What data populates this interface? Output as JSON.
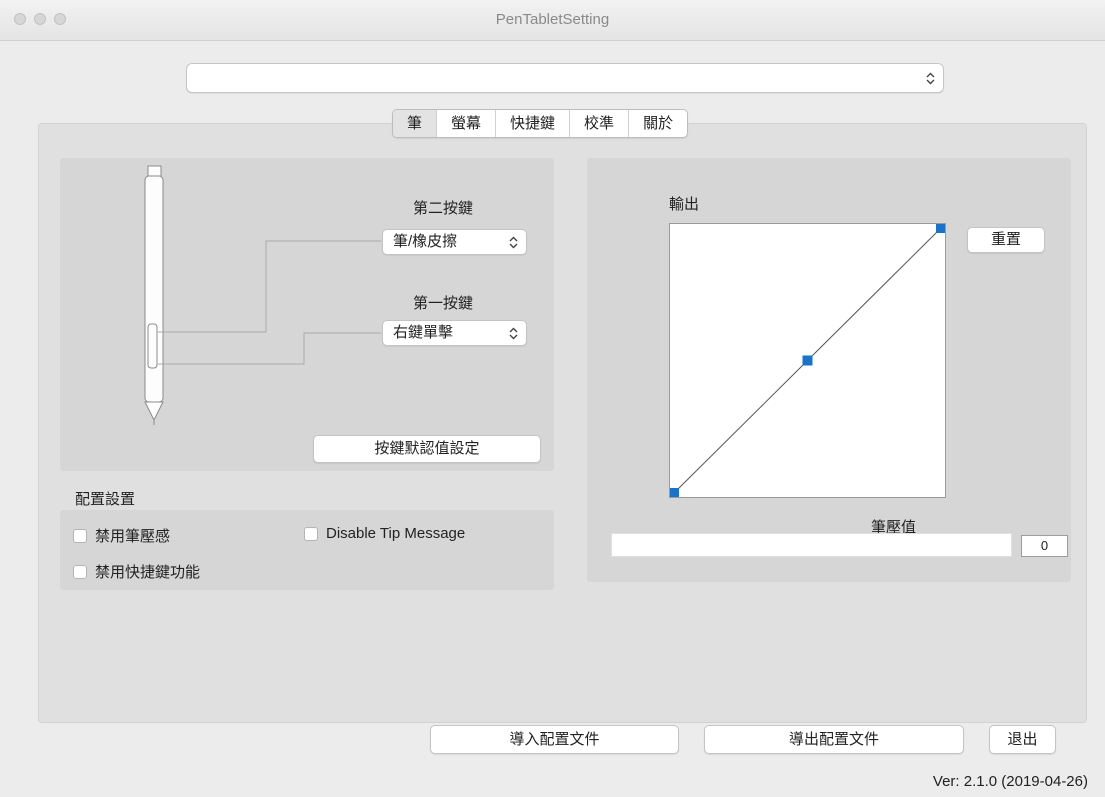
{
  "window": {
    "title": "PenTabletSetting"
  },
  "device_select": {
    "value": ""
  },
  "tabs": [
    {
      "label": "筆",
      "active": true
    },
    {
      "label": "螢幕",
      "active": false
    },
    {
      "label": "快捷鍵",
      "active": false
    },
    {
      "label": "校準",
      "active": false
    },
    {
      "label": "關於",
      "active": false
    }
  ],
  "pen": {
    "second_button_label": "第二按鍵",
    "second_button_value": "筆/橡皮擦",
    "first_button_label": "第一按鍵",
    "first_button_value": "右鍵單擊",
    "default_button": "按鍵默認值設定"
  },
  "config": {
    "title": "配置設置",
    "disable_pressure": "禁用筆壓感",
    "disable_tip_message": "Disable Tip Message",
    "disable_shortcuts": "禁用快捷鍵功能"
  },
  "curve": {
    "output_label": "輸出",
    "reset_button": "重置",
    "pressure_label": "筆壓值",
    "pressure_value": "0",
    "points": [
      [
        0,
        0
      ],
      [
        0.5,
        0.5
      ],
      [
        1,
        1
      ]
    ],
    "accent_color": "#1a73c8"
  },
  "footer": {
    "import_button": "導入配置文件",
    "export_button": "導出配置文件",
    "exit_button": "退出",
    "version": "Ver: 2.1.0 (2019-04-26)"
  }
}
